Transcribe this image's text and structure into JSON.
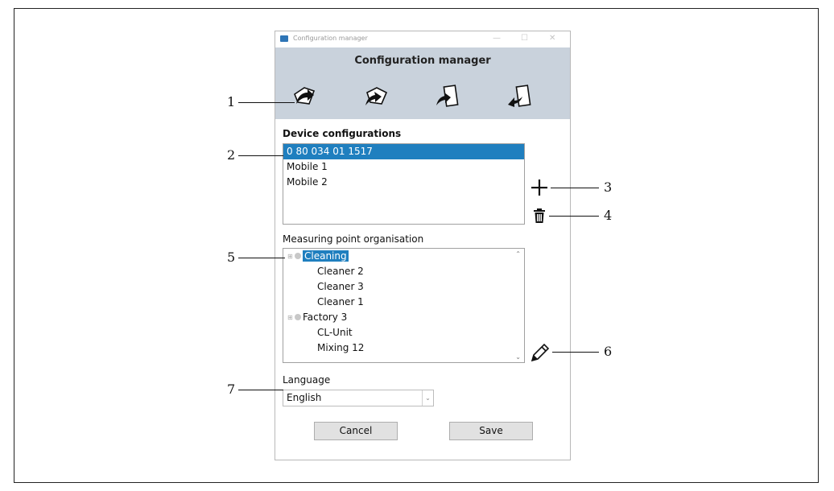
{
  "window": {
    "title": "Configuration manager",
    "heading": "Configuration manager",
    "controls": {
      "minimize": "—",
      "maximize": "☐",
      "close": "✕"
    }
  },
  "toolbar": {
    "icons": [
      "load-configuration-icon",
      "save-configuration-icon",
      "import-configuration-icon",
      "export-configuration-icon"
    ]
  },
  "device_configurations": {
    "label": "Device configurations",
    "items": [
      "0 80 034 01 1517",
      "Mobile 1",
      "Mobile 2"
    ],
    "selected_index": 0
  },
  "measuring_point": {
    "label": "Measuring point organisation",
    "tree": [
      {
        "label": "Cleaning",
        "selected": true,
        "children": [
          "Cleaner 2",
          "Cleaner 3",
          "Cleaner 1"
        ]
      },
      {
        "label": "Factory 3",
        "selected": false,
        "children": [
          "CL-Unit",
          "Mixing 12"
        ]
      }
    ],
    "expander_glyph": "⊞",
    "scroll_up": "⌃",
    "scroll_down": "⌄"
  },
  "language": {
    "label": "Language",
    "value": "English",
    "arrow": "⌄"
  },
  "buttons": {
    "cancel": "Cancel",
    "save": "Save"
  },
  "side_actions": {
    "add": "add-icon",
    "delete": "trash-icon",
    "edit": "pencil-icon"
  },
  "callouts": [
    "1",
    "2",
    "3",
    "4",
    "5",
    "6",
    "7"
  ],
  "colors": {
    "selection": "#1f7fbf",
    "toolbar_bg": "#c9d2dc"
  }
}
